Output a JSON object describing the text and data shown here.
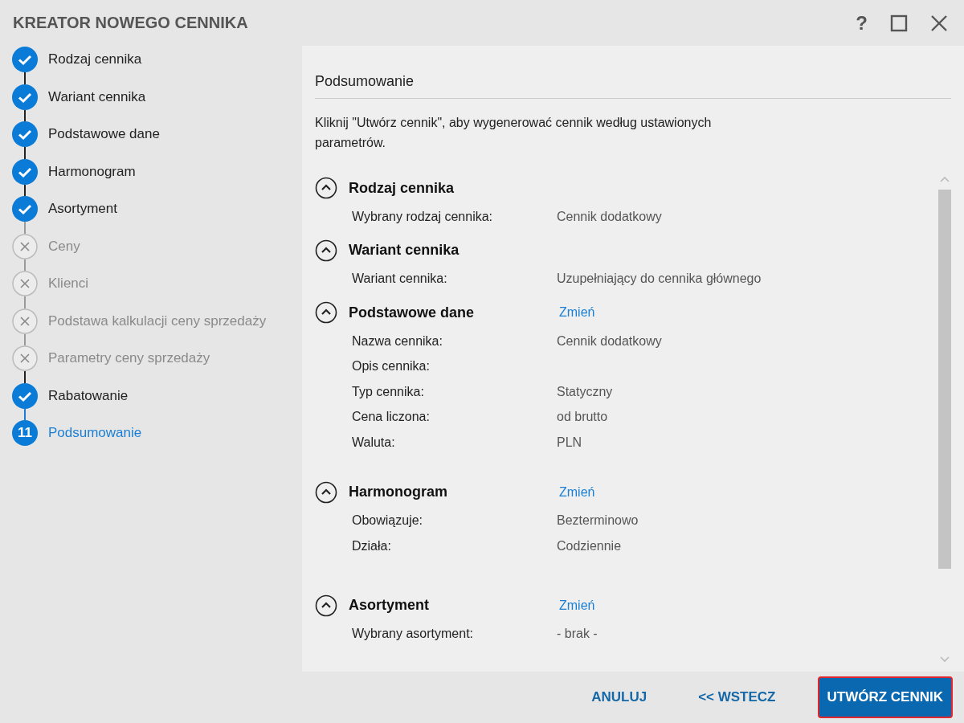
{
  "window": {
    "title": "KREATOR NOWEGO CENNIKA",
    "help": "?"
  },
  "steps": [
    {
      "label": "Rodzaj cennika",
      "kind": "done"
    },
    {
      "label": "Wariant cennika",
      "kind": "done"
    },
    {
      "label": "Podstawowe dane",
      "kind": "done"
    },
    {
      "label": "Harmonogram",
      "kind": "done"
    },
    {
      "label": "Asortyment",
      "kind": "done"
    },
    {
      "label": "Ceny",
      "kind": "skipped"
    },
    {
      "label": "Klienci",
      "kind": "skipped"
    },
    {
      "label": "Podstawa kalkulacji ceny sprzedaży",
      "kind": "skipped"
    },
    {
      "label": "Parametry ceny sprzedaży",
      "kind": "skipped"
    },
    {
      "label": "Rabatowanie",
      "kind": "done"
    },
    {
      "label": "Podsumowanie",
      "kind": "current",
      "number": "11"
    }
  ],
  "summary": {
    "heading": "Podsumowanie",
    "description": "Kliknij \"Utwórz cennik\", aby wygenerować cennik według ustawionych parametrów.",
    "sections": [
      {
        "title": "Rodzaj cennika",
        "expanded": true,
        "rows": [
          {
            "label": "Wybrany rodzaj cennika:",
            "value": "Cennik dodatkowy"
          }
        ]
      },
      {
        "title": "Wariant cennika",
        "expanded": true,
        "rows": [
          {
            "label": "Wariant cennika:",
            "value": "Uzupełniający do cennika głównego"
          }
        ]
      },
      {
        "title": "Podstawowe dane",
        "expanded": true,
        "change_link": "Zmień",
        "rows": [
          {
            "label": "Nazwa cennika:",
            "value": "Cennik dodatkowy"
          },
          {
            "label": "Opis cennika:"
          },
          {
            "label": "Typ cennika:",
            "value": "Statyczny"
          },
          {
            "label": "Cena liczona:",
            "value": "od brutto"
          },
          {
            "label": "Waluta:",
            "value": "PLN"
          }
        ]
      },
      {
        "title": "Harmonogram",
        "expanded": true,
        "change_link": "Zmień",
        "rows": [
          {
            "label": "Obowiązuje:",
            "value": "Bezterminowo"
          },
          {
            "label": "Działa:",
            "value": "Codziennie"
          }
        ]
      },
      {
        "title": "Asortyment",
        "expanded": true,
        "change_link": "Zmień",
        "rows": [
          {
            "label": "Wybrany asortyment:",
            "value": "- brak -"
          }
        ]
      }
    ]
  },
  "footer": {
    "buttons": [
      {
        "label": "ANULUJ",
        "kind": "link"
      },
      {
        "label": "<< WSTECZ",
        "kind": "link"
      },
      {
        "label": "UTWÓRZ CENNIK",
        "kind": "primary"
      }
    ]
  }
}
